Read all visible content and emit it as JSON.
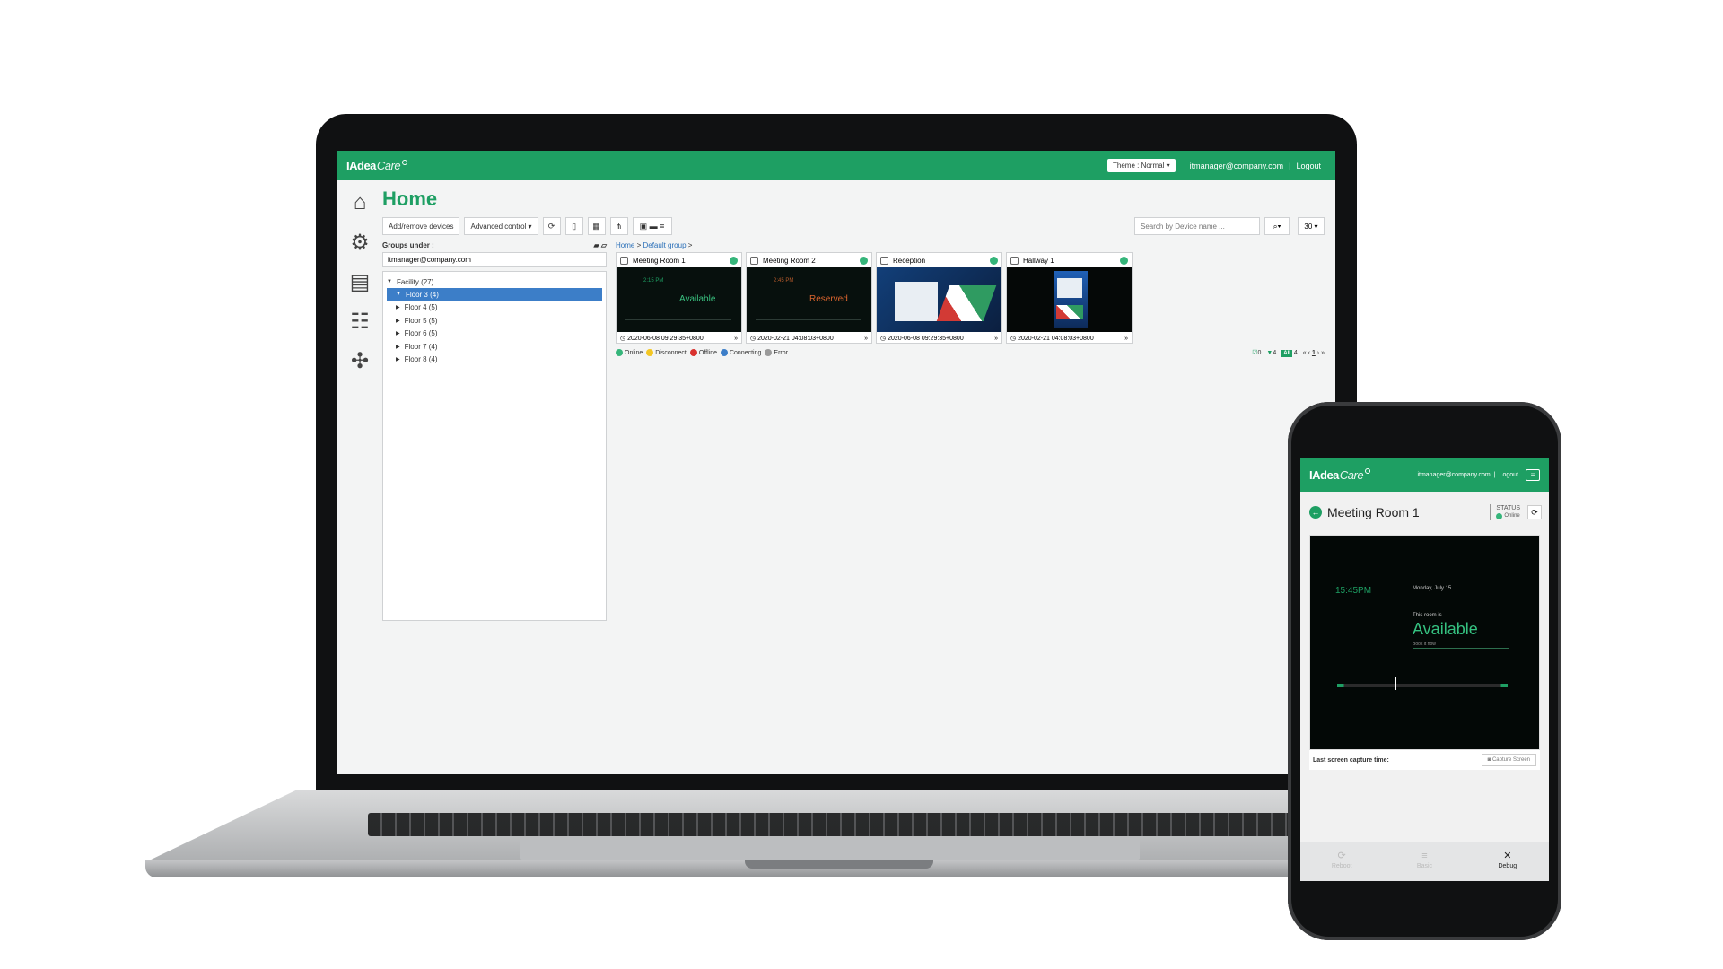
{
  "laptop": {
    "header": {
      "logo_main": "IAdea",
      "logo_care": "Care",
      "theme_label": "Theme : Normal ▾",
      "email": "itmanager@company.com",
      "logout": "Logout"
    },
    "page_title": "Home",
    "toolbar": {
      "add_remove": "Add/remove devices",
      "advanced": "Advanced control ▾",
      "search_placeholder": "Search by Device name ...",
      "page_size": "30 ▾"
    },
    "groups": {
      "label": "Groups under :",
      "user": "itmanager@company.com",
      "root": "Facility (27)",
      "items": [
        "Floor 3 (4)",
        "Floor 4 (5)",
        "Floor 5 (5)",
        "Floor 6 (5)",
        "Floor 7 (4)",
        "Floor 8 (4)"
      ]
    },
    "breadcrumb": {
      "home": "Home",
      "group": "Default group"
    },
    "devices": [
      {
        "name": "Meeting Room 1",
        "timestamp": "2020-06-08 09:29:35+0800",
        "state": "Available",
        "time": "2:15 PM"
      },
      {
        "name": "Meeting Room 2",
        "timestamp": "2020-02-21 04:08:03+0800",
        "state": "Reserved",
        "time": "2:45 PM"
      },
      {
        "name": "Reception",
        "timestamp": "2020-06-08 09:29:35+0800"
      },
      {
        "name": "Hallway 1",
        "timestamp": "2020-02-21 04:08:03+0800"
      }
    ],
    "legend": [
      "Online",
      "Disconnect",
      "Offline",
      "Connecting",
      "Error"
    ],
    "summary": {
      "checked": "0",
      "filtered": "4",
      "all_badge": "All",
      "total": "4",
      "page": "1"
    }
  },
  "phone": {
    "email": "itmanager@company.com",
    "logout": "Logout",
    "device_name": "Meeting Room 1",
    "status_label": "STATUS",
    "status_value": "Online",
    "preview": {
      "time": "15:45PM",
      "date": "Monday, July 15",
      "room_text": "This room is",
      "state": "Available",
      "book_text": "Book it now"
    },
    "capture_label": "Last screen capture time:",
    "capture_button": "Capture Screen",
    "tabs": [
      "Reboot",
      "Basic",
      "Debug"
    ]
  },
  "colors": {
    "brand": "#1e9f63",
    "online": "#35b57a",
    "disconnect": "#f3c623",
    "offline": "#d9322f",
    "connecting": "#3c7ec8",
    "error": "#9a9a9a"
  }
}
